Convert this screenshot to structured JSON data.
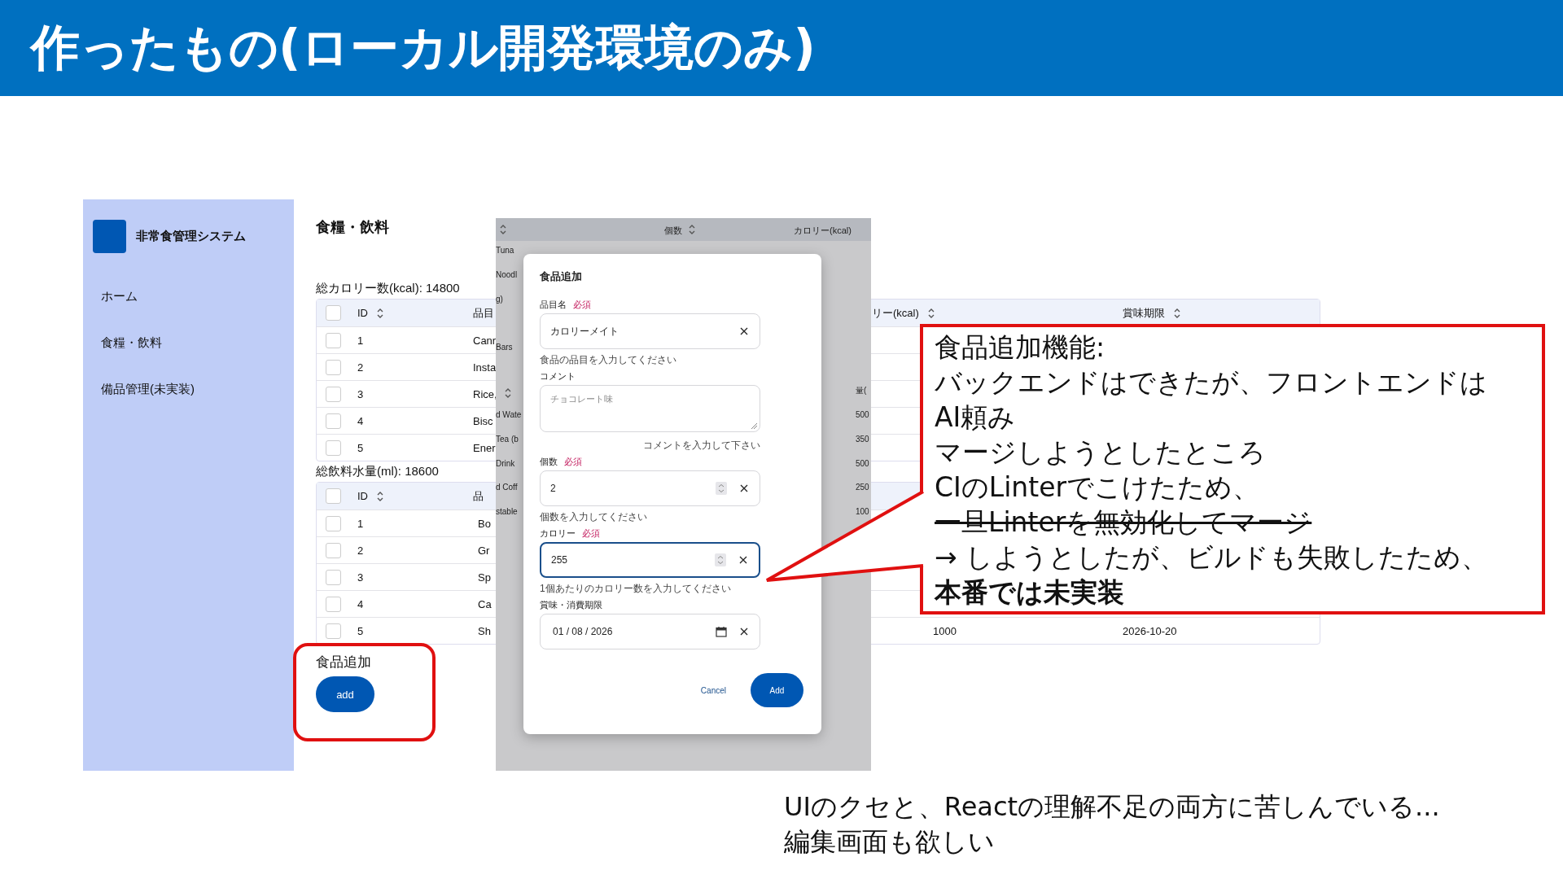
{
  "slide_title": "作ったもの(ローカル開発環境のみ)",
  "app": {
    "sidebar": {
      "app_name": "非常食管理システム",
      "items": [
        {
          "label": "ホーム"
        },
        {
          "label": "食糧・飲料"
        },
        {
          "label": "備品管理(未実装)"
        }
      ]
    },
    "page_title": "食糧・飲料",
    "food_total": "総カロリー数(kcal): 14800",
    "food_table": {
      "header_checked": false,
      "columns": [
        "ID",
        "品目",
        "リー(kcal)",
        "賞味期限"
      ],
      "rows": [
        {
          "checked": false,
          "id": "1",
          "column_2": "Canr"
        },
        {
          "checked": false,
          "id": "2",
          "column_2": "Insta"
        },
        {
          "checked": false,
          "id": "3",
          "column_2": "Rice,"
        },
        {
          "checked": false,
          "id": "4",
          "column_2": "Bisc"
        },
        {
          "checked": false,
          "id": "5",
          "column_2": "Ener"
        }
      ]
    },
    "drink_total": "総飲料水量(ml): 18600",
    "drink_table": {
      "header_checked": false,
      "columns": [
        "ID",
        "品"
      ],
      "rows": [
        {
          "checked": false,
          "id": "1",
          "column_2": "Bo"
        },
        {
          "checked": false,
          "id": "2",
          "column_2": "Gr"
        },
        {
          "checked": false,
          "id": "3",
          "column_2": "Sp"
        },
        {
          "checked": false,
          "id": "4",
          "column_2": "Ca"
        },
        {
          "checked": false,
          "id": "5",
          "column_2": "Sh",
          "column_3": "1000",
          "column_4": "2026-10-20"
        }
      ]
    },
    "add_label": "食品追加",
    "add_button": "add"
  },
  "background_screen": {
    "header": [
      "個数",
      "カロリー(kcal)"
    ],
    "left_fragments": [
      "Tuna",
      "Noodl",
      "g)",
      "Bars",
      "d Wate",
      "Tea (b",
      "Drink",
      "d Coff",
      "stable"
    ],
    "right_fragments": [
      "量(",
      "500",
      "350",
      "500",
      "250",
      "100"
    ]
  },
  "dialog": {
    "title": "食品追加",
    "fields": [
      {
        "kind": "text",
        "label": "品目名",
        "required_label": "必須",
        "value": "カロリーメイト",
        "helper": "食品の品目を入力してください",
        "focused": false
      },
      {
        "kind": "textarea",
        "label": "コメント",
        "placeholder": "チョコレート味",
        "helper": "コメントを入力して下さい",
        "focused": false
      },
      {
        "kind": "number",
        "label": "個数",
        "required_label": "必須",
        "value": "2",
        "helper": "個数を入力してください",
        "focused": false
      },
      {
        "kind": "number",
        "label": "カロリー",
        "required_label": "必須",
        "value": "255",
        "helper": "1個あたりのカロリー数を入力してください",
        "focused": true
      },
      {
        "kind": "date",
        "label": "賞味・消費期限",
        "value": "01 / 08 / 2026",
        "focused": false
      }
    ],
    "cancel_button": "Cancel",
    "add_button": "Add"
  },
  "callout": {
    "lines": [
      {
        "kind": "normal",
        "text": "食品追加機能:"
      },
      {
        "kind": "normal",
        "text": "バックエンドはできたが、フロントエンドは"
      },
      {
        "kind": "normal",
        "text": "AI頼み"
      },
      {
        "kind": "normal",
        "text": "マージしようとしたところ"
      },
      {
        "kind": "normal",
        "text": "CIのLinterでこけたため、"
      },
      {
        "kind": "strike",
        "text": "一旦Linterを無効化してマージ"
      },
      {
        "kind": "normal",
        "text": "→ しようとしたが、ビルドも失敗したため、"
      },
      {
        "kind": "bold",
        "text": "本番では未実装"
      }
    ]
  },
  "note": [
    "UIのクセと、Reactの理解不足の両方に苦しんでいる...",
    "編集画面も欲しい"
  ]
}
